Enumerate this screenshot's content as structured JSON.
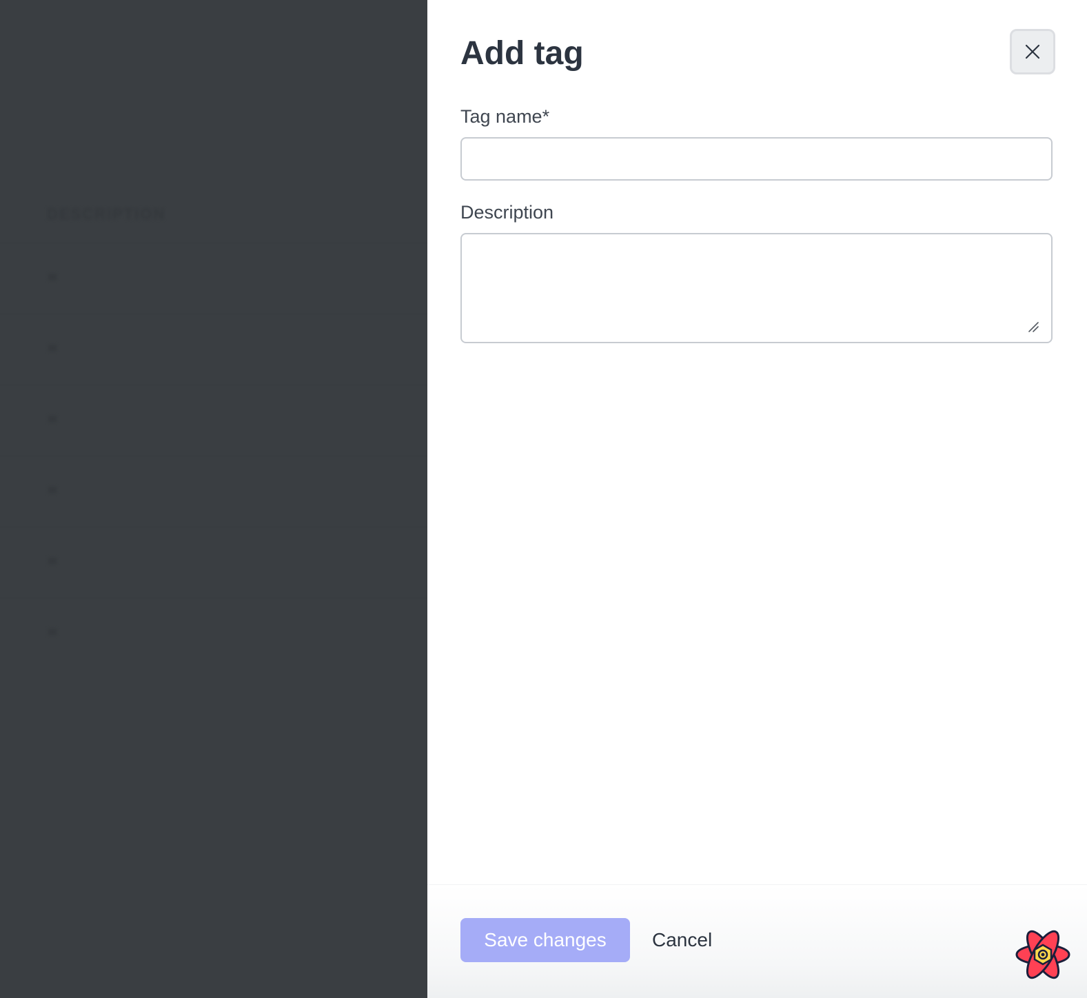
{
  "panel": {
    "title": "Add tag",
    "close_icon": "close-icon"
  },
  "form": {
    "tag_name": {
      "label": "Tag name*",
      "value": "",
      "placeholder": ""
    },
    "description": {
      "label": "Description",
      "value": "",
      "placeholder": ""
    }
  },
  "footer": {
    "save_label": "Save changes",
    "cancel_label": "Cancel",
    "devtools_icon": "react-query-devtools-icon"
  },
  "colors": {
    "backdrop": "#3a3e42",
    "primary_disabled": "#a5acf7",
    "title_text": "#2c3440",
    "input_border": "#c7cbd1"
  }
}
